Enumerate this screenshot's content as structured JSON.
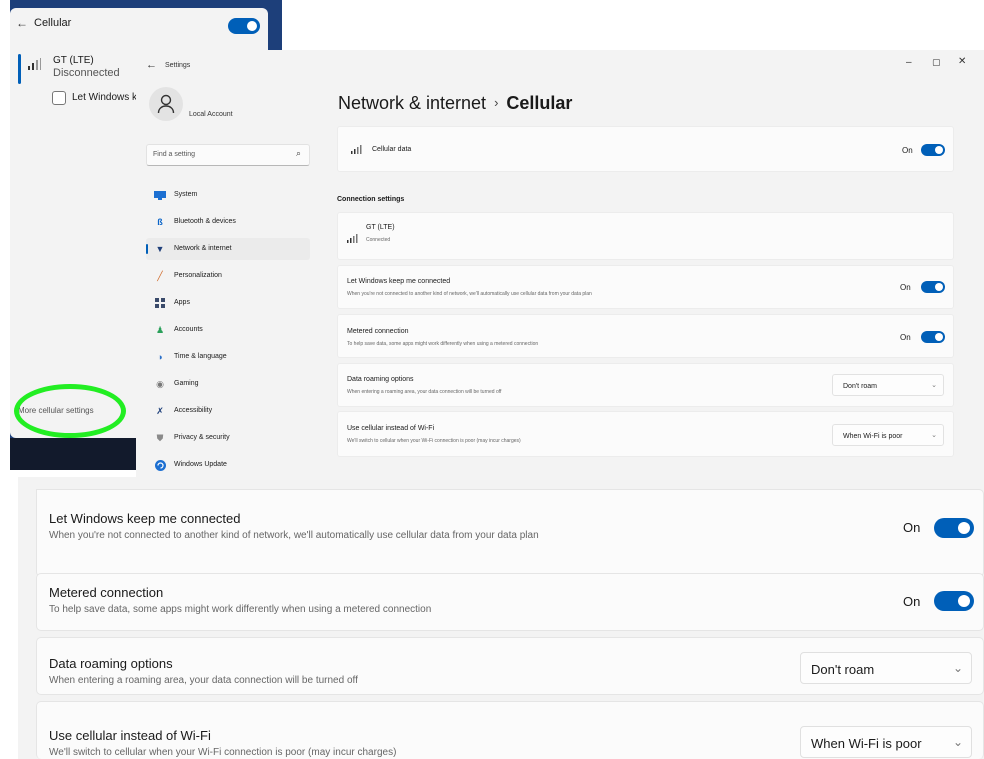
{
  "flyout": {
    "back_glyph": "←",
    "title": "Cellular",
    "network": {
      "name": "GT (LTE)",
      "status": "Disconnected"
    },
    "checkbox_label": "Let Windows keep me connected",
    "more_link": "More cellular settings",
    "highlight_color": "#22ee22"
  },
  "window": {
    "back_glyph": "←",
    "app_title": "Settings",
    "min_glyph": "–",
    "max_glyph": "▢",
    "close_glyph": "✕"
  },
  "account": {
    "name": "Local Account",
    "avatar_icon": "person-icon"
  },
  "search": {
    "placeholder": "Find a setting",
    "icon": "search-icon"
  },
  "nav": [
    {
      "label": "System",
      "icon": "monitor-icon",
      "active": false
    },
    {
      "label": "Bluetooth & devices",
      "icon": "bluetooth-icon",
      "active": false
    },
    {
      "label": "Network & internet",
      "icon": "wifi-icon",
      "active": true
    },
    {
      "label": "Personalization",
      "icon": "brush-icon",
      "active": false
    },
    {
      "label": "Apps",
      "icon": "apps-icon",
      "active": false
    },
    {
      "label": "Accounts",
      "icon": "accounts-icon",
      "active": false
    },
    {
      "label": "Time & language",
      "icon": "globe-clock-icon",
      "active": false
    },
    {
      "label": "Gaming",
      "icon": "gamepad-icon",
      "active": false
    },
    {
      "label": "Accessibility",
      "icon": "accessibility-icon",
      "active": false
    },
    {
      "label": "Privacy & security",
      "icon": "shield-icon",
      "active": false
    },
    {
      "label": "Windows Update",
      "icon": "update-icon",
      "active": false
    }
  ],
  "breadcrumb": {
    "parent": "Network & internet",
    "separator": "›",
    "current": "Cellular"
  },
  "cellular_data": {
    "label": "Cellular data",
    "state": "On"
  },
  "connection_heading": "Connection settings",
  "network_card": {
    "name": "GT (LTE)",
    "status": "Connected"
  },
  "settings": {
    "keep_connected": {
      "title": "Let Windows keep me connected",
      "desc": "When you're not connected to another kind of network, we'll automatically use cellular data from your data plan",
      "state": "On"
    },
    "metered": {
      "title": "Metered connection",
      "desc": "To help save data, some apps might work differently when using a metered connection",
      "state": "On"
    },
    "roaming": {
      "title": "Data roaming options",
      "desc": "When entering a roaming area, your data connection will be turned off",
      "value": "Don't roam"
    },
    "cellular_wifi": {
      "title": "Use cellular instead of Wi-Fi",
      "desc": "We'll switch to cellular when your Wi-Fi connection is poor (may incur charges)",
      "value": "When Wi-Fi is poor"
    }
  },
  "colors": {
    "accent": "#005fb8",
    "flyout_frame": "#1d3f7a"
  }
}
